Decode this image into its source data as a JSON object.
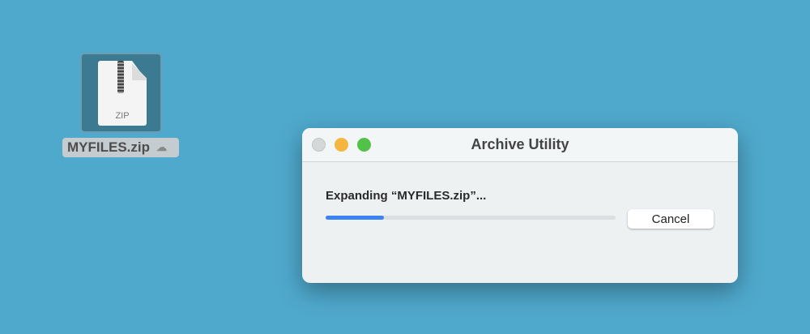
{
  "desktop": {
    "file": {
      "name": "MYFILES.zip",
      "type_label": "ZIP",
      "cloud_icon": "cloud-alert-icon"
    }
  },
  "window": {
    "title": "Archive Utility",
    "message": "Expanding “MYFILES.zip”...",
    "progress": 0.2,
    "cancel_label": "Cancel",
    "accent": "#3b82f6"
  }
}
